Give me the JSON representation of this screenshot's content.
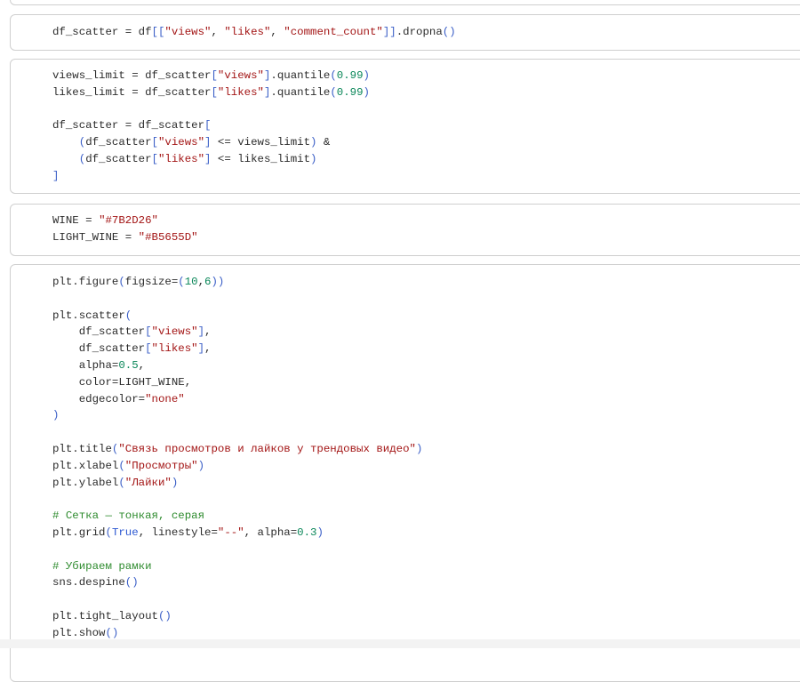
{
  "cells": [
    {
      "lines": []
    },
    {
      "lines": [
        [
          [
            "t",
            "df_scatter = df"
          ],
          [
            "b",
            "[["
          ],
          [
            "s",
            "\"views\""
          ],
          [
            "t",
            ", "
          ],
          [
            "s",
            "\"likes\""
          ],
          [
            "t",
            ", "
          ],
          [
            "s",
            "\"comment_count\""
          ],
          [
            "b",
            "]]"
          ],
          [
            "t",
            ".dropna"
          ],
          [
            "b",
            "()"
          ]
        ]
      ]
    },
    {
      "lines": [
        [
          [
            "t",
            "views_limit = df_scatter"
          ],
          [
            "b",
            "["
          ],
          [
            "s",
            "\"views\""
          ],
          [
            "b",
            "]"
          ],
          [
            "t",
            ".quantile"
          ],
          [
            "b",
            "("
          ],
          [
            "n",
            "0.99"
          ],
          [
            "b",
            ")"
          ]
        ],
        [
          [
            "t",
            "likes_limit = df_scatter"
          ],
          [
            "b",
            "["
          ],
          [
            "s",
            "\"likes\""
          ],
          [
            "b",
            "]"
          ],
          [
            "t",
            ".quantile"
          ],
          [
            "b",
            "("
          ],
          [
            "n",
            "0.99"
          ],
          [
            "b",
            ")"
          ]
        ],
        [],
        [
          [
            "t",
            "df_scatter = df_scatter"
          ],
          [
            "b",
            "["
          ]
        ],
        [
          [
            "t",
            "    "
          ],
          [
            "b",
            "("
          ],
          [
            "t",
            "df_scatter"
          ],
          [
            "b",
            "["
          ],
          [
            "s",
            "\"views\""
          ],
          [
            "b",
            "]"
          ],
          [
            "t",
            " <= views_limit"
          ],
          [
            "b",
            ")"
          ],
          [
            "t",
            " &"
          ]
        ],
        [
          [
            "t",
            "    "
          ],
          [
            "b",
            "("
          ],
          [
            "t",
            "df_scatter"
          ],
          [
            "b",
            "["
          ],
          [
            "s",
            "\"likes\""
          ],
          [
            "b",
            "]"
          ],
          [
            "t",
            " <= likes_limit"
          ],
          [
            "b",
            ")"
          ]
        ],
        [
          [
            "b",
            "]"
          ]
        ]
      ]
    },
    {
      "lines": [
        [
          [
            "t",
            "WINE = "
          ],
          [
            "s",
            "\"#7B2D26\""
          ]
        ],
        [
          [
            "t",
            "LIGHT_WINE = "
          ],
          [
            "s",
            "\"#B5655D\""
          ]
        ]
      ]
    },
    {
      "lines": [
        [
          [
            "t",
            "plt.figure"
          ],
          [
            "b",
            "("
          ],
          [
            "t",
            "figsize="
          ],
          [
            "b",
            "("
          ],
          [
            "n",
            "10"
          ],
          [
            "t",
            ","
          ],
          [
            "n",
            "6"
          ],
          [
            "b",
            "))"
          ]
        ],
        [],
        [
          [
            "t",
            "plt.scatter"
          ],
          [
            "b",
            "("
          ]
        ],
        [
          [
            "t",
            "    df_scatter"
          ],
          [
            "b",
            "["
          ],
          [
            "s",
            "\"views\""
          ],
          [
            "b",
            "]"
          ],
          [
            "t",
            ","
          ]
        ],
        [
          [
            "t",
            "    df_scatter"
          ],
          [
            "b",
            "["
          ],
          [
            "s",
            "\"likes\""
          ],
          [
            "b",
            "]"
          ],
          [
            "t",
            ","
          ]
        ],
        [
          [
            "t",
            "    alpha="
          ],
          [
            "n",
            "0.5"
          ],
          [
            "t",
            ","
          ]
        ],
        [
          [
            "t",
            "    color=LIGHT_WINE,"
          ]
        ],
        [
          [
            "t",
            "    edgecolor="
          ],
          [
            "s",
            "\"none\""
          ]
        ],
        [
          [
            "b",
            ")"
          ]
        ],
        [],
        [
          [
            "t",
            "plt.title"
          ],
          [
            "b",
            "("
          ],
          [
            "s",
            "\"Связь просмотров и лайков у трендовых видео\""
          ],
          [
            "b",
            ")"
          ]
        ],
        [
          [
            "t",
            "plt.xlabel"
          ],
          [
            "b",
            "("
          ],
          [
            "s",
            "\"Просмотры\""
          ],
          [
            "b",
            ")"
          ]
        ],
        [
          [
            "t",
            "plt.ylabel"
          ],
          [
            "b",
            "("
          ],
          [
            "s",
            "\"Лайки\""
          ],
          [
            "b",
            ")"
          ]
        ],
        [],
        [
          [
            "c",
            "# Сетка — тонкая, серая"
          ]
        ],
        [
          [
            "t",
            "plt.grid"
          ],
          [
            "b",
            "("
          ],
          [
            "k",
            "True"
          ],
          [
            "t",
            ", linestyle="
          ],
          [
            "s",
            "\"--\""
          ],
          [
            "t",
            ", alpha="
          ],
          [
            "n",
            "0.3"
          ],
          [
            "b",
            ")"
          ]
        ],
        [],
        [
          [
            "c",
            "# Убираем рамки"
          ]
        ],
        [
          [
            "t",
            "sns.despine"
          ],
          [
            "b",
            "()"
          ]
        ],
        [],
        [
          [
            "t",
            "plt.tight_layout"
          ],
          [
            "b",
            "()"
          ]
        ],
        [
          [
            "t",
            "plt.show"
          ],
          [
            "b",
            "()"
          ]
        ]
      ]
    }
  ],
  "colors": {
    "string": "#a31515",
    "number": "#098658",
    "bracket": "#3b5fc7",
    "comment": "#2e8b2e"
  }
}
